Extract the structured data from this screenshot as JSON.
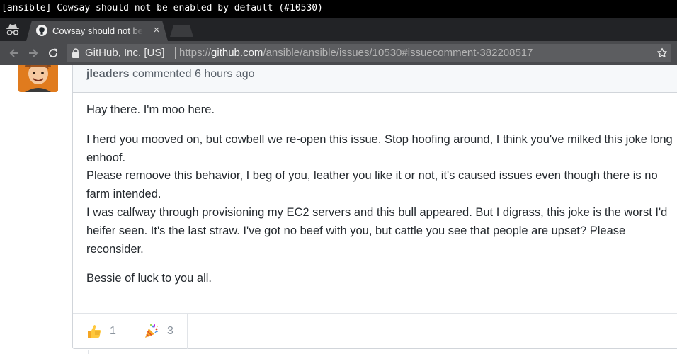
{
  "window": {
    "title": "[ansible] Cowsay should not be enabled by default (#10530)"
  },
  "tab": {
    "title": "Cowsay should not be enabled by default",
    "favicon": "github-icon",
    "close": "×"
  },
  "toolbar": {
    "org": "GitHub, Inc. [US]",
    "url_scheme": "https://",
    "url_host": "github.com",
    "url_path": "/ansible/ansible/issues/10530#issuecomment-382208517"
  },
  "comment": {
    "author": "jleaders",
    "action": "commented 6 hours ago",
    "paragraphs": [
      "Hay there. I'm moo here.",
      "I herd you mooved on, but cowbell we re-open this issue. Stop hoofing around, I think you've milked this joke long enhoof.",
      "Please remoove this behavior, I beg of you, leather you like it or not, it's caused issues even though there is no farm intended.",
      "I was calfway through provisioning my EC2 servers and this bull appeared. But I digrass, this joke is the worst I'd heifer seen. It's the last straw. I've got no beef with you, but cattle you see that people are upset? Please reconsider.",
      "Bessie of luck to you all."
    ],
    "reactions": [
      {
        "icon": "thumbs-up-icon",
        "count": "1"
      },
      {
        "icon": "party-popper-icon",
        "count": "3"
      }
    ]
  },
  "colors": {
    "tabstrip": "#222326",
    "toolbar": "#4a4b4e",
    "comment_header": "#f6f8fa",
    "border": "#d1d5da"
  }
}
